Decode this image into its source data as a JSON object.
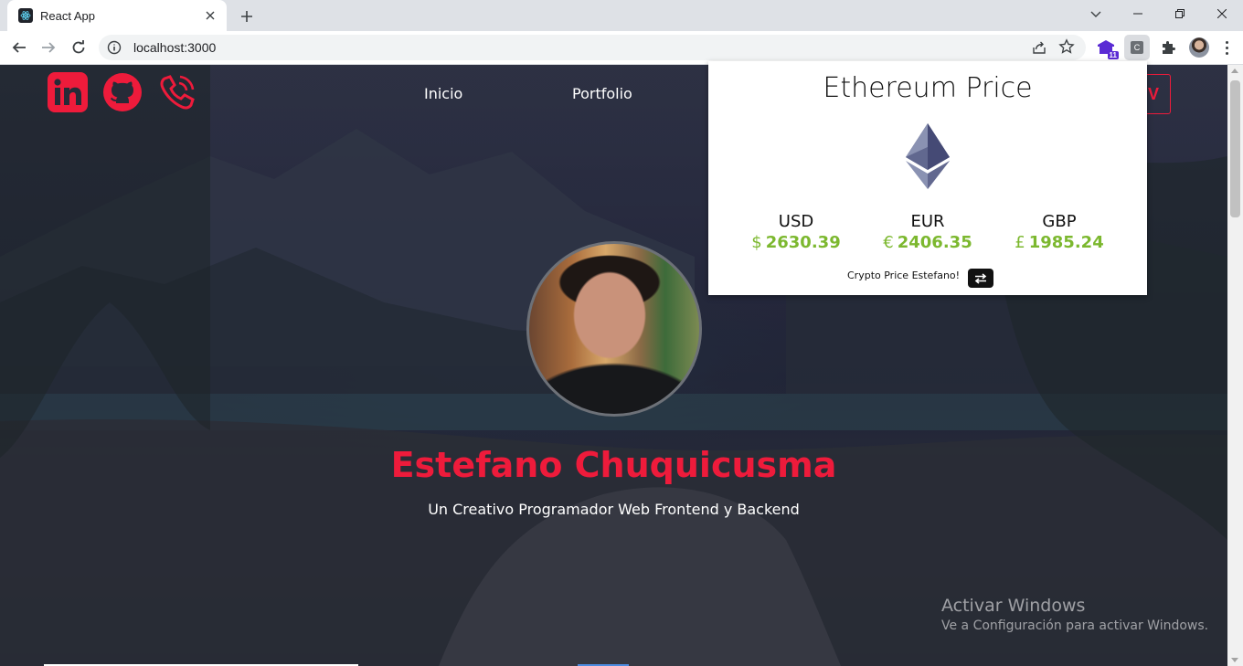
{
  "browser": {
    "tab_title": "React App",
    "url": "localhost:3000",
    "extension_badge": "11",
    "extension_letter": "C"
  },
  "site": {
    "nav": [
      "Inicio",
      "Portfolio"
    ],
    "cv_label": "V",
    "hero_name": "Estefano Chuquicusma",
    "hero_subtitle": "Un Creativo Programador Web Frontend y Backend",
    "accent_color": "#ee1b3b",
    "social_icons": [
      "linkedin-icon",
      "github-icon",
      "phone-icon"
    ]
  },
  "popup": {
    "title": "Ethereum Price",
    "prices": [
      {
        "currency": "USD",
        "symbol": "$",
        "value": "2630.39"
      },
      {
        "currency": "EUR",
        "symbol": "€",
        "value": "2406.35"
      },
      {
        "currency": "GBP",
        "symbol": "£",
        "value": "1985.24"
      }
    ],
    "footer": "Crypto Price Estefano!",
    "price_color": "#7cb82f"
  },
  "os_watermark": {
    "title": "Activar Windows",
    "subtitle": "Ve a Configuración para activar Windows."
  }
}
